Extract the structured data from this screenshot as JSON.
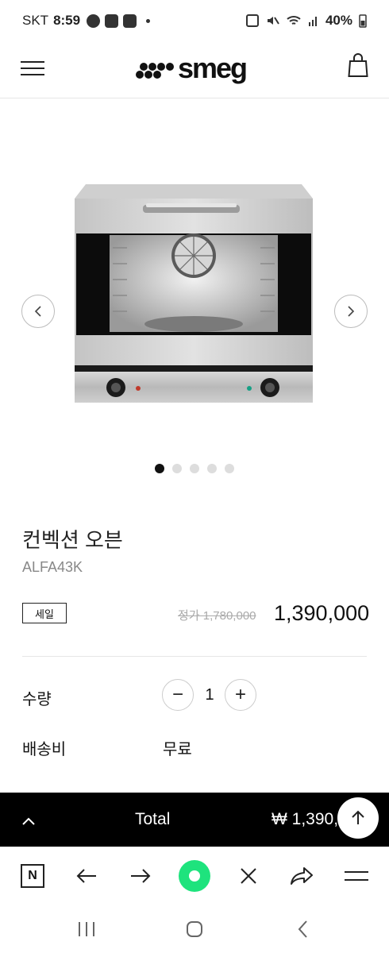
{
  "status_bar": {
    "carrier": "SKT",
    "time": "8:59",
    "battery": "40%"
  },
  "header": {
    "logo": "smeg"
  },
  "carousel": {
    "image_count": 5,
    "active_index": 0
  },
  "product": {
    "name": "컨벡션 오븐",
    "model": "ALFA43K",
    "badge": "세일",
    "original_price": "정가 1,780,000",
    "sale_price": "1,390,000"
  },
  "options": {
    "quantity_label": "수량",
    "quantity_value": "1",
    "minus_label": "−",
    "plus_label": "+",
    "shipping_label": "배송비",
    "shipping_value": "무료"
  },
  "total_bar": {
    "label": "Total",
    "value": "₩ 1,390,000"
  },
  "browser_toolbar": {
    "n_label": "N"
  },
  "colors": {
    "accent_green": "#1ee37d",
    "total_bar_bg": "#000000"
  }
}
